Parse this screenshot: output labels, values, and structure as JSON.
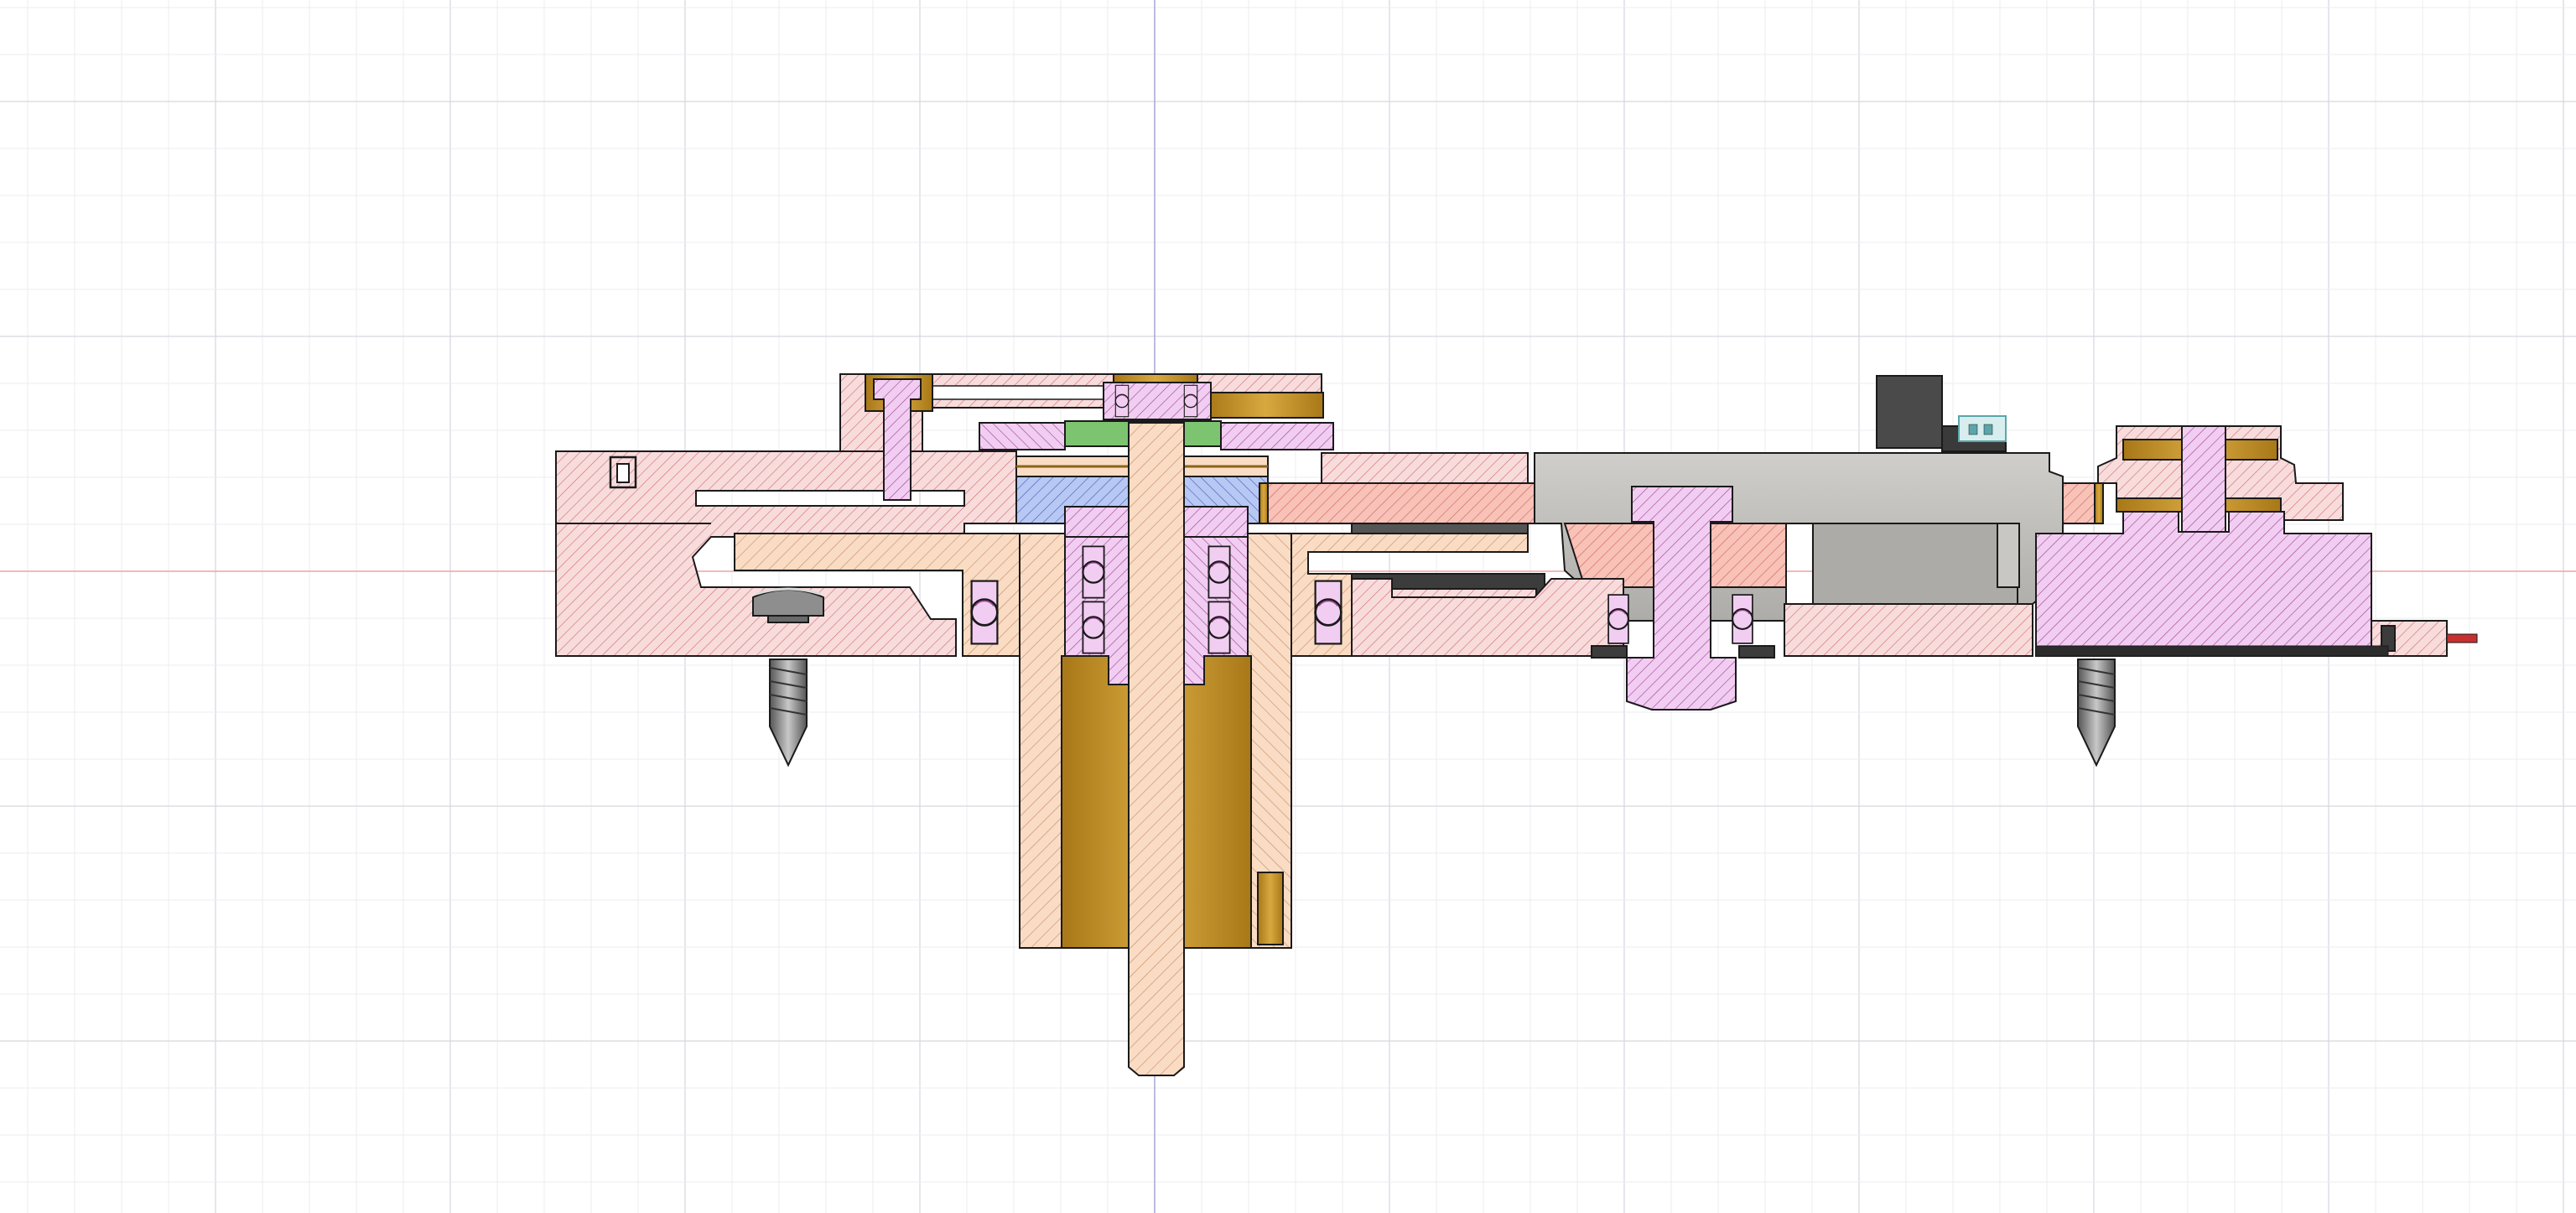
{
  "app": {
    "view": "section-analysis-viewport"
  },
  "colors": {
    "background": "#ffffff",
    "grid_minor": "#ececf0",
    "grid_major": "#d6d6de",
    "axis_x": "#f0a8a0",
    "axis_y": "#a8a8d8",
    "outline": "#1a1a1a",
    "hatch_pink": "#f8dcdc",
    "hatch_pink_line": "#d0707a",
    "hatch_peach": "#fadcc4",
    "hatch_peach_line": "#c8906a",
    "hatch_salmon": "#f8c2b8",
    "hatch_salmon_line": "#d06a5a",
    "hatch_magenta": "#f2cdf2",
    "hatch_magenta_line": "#a04a98",
    "hatch_blue": "#b8c8f4",
    "hatch_blue_line": "#4a60b8",
    "bronze": "#c9962a",
    "bronze_dark": "#8a6418",
    "green": "#7cc470",
    "gray": "#bcbab6",
    "dark_gray": "#4a4a4a",
    "red_wire": "#c83030"
  },
  "icons": {
    "screw_left": "screw-icon",
    "screw_right": "screw-icon",
    "bearing": "ball-bearing-icon"
  }
}
